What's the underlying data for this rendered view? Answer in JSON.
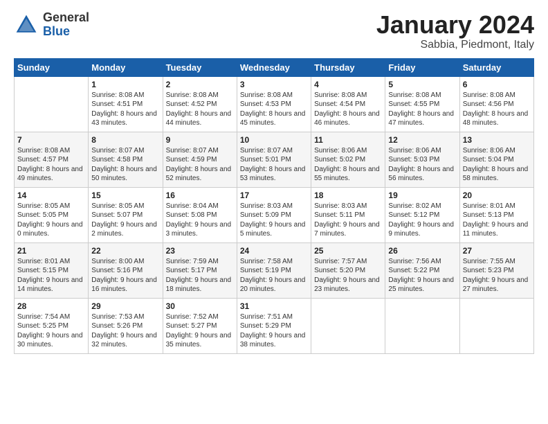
{
  "header": {
    "logo_general": "General",
    "logo_blue": "Blue",
    "month": "January 2024",
    "location": "Sabbia, Piedmont, Italy"
  },
  "weekdays": [
    "Sunday",
    "Monday",
    "Tuesday",
    "Wednesday",
    "Thursday",
    "Friday",
    "Saturday"
  ],
  "weeks": [
    [
      {
        "day": "",
        "sunrise": "",
        "sunset": "",
        "daylight": ""
      },
      {
        "day": "1",
        "sunrise": "Sunrise: 8:08 AM",
        "sunset": "Sunset: 4:51 PM",
        "daylight": "Daylight: 8 hours and 43 minutes."
      },
      {
        "day": "2",
        "sunrise": "Sunrise: 8:08 AM",
        "sunset": "Sunset: 4:52 PM",
        "daylight": "Daylight: 8 hours and 44 minutes."
      },
      {
        "day": "3",
        "sunrise": "Sunrise: 8:08 AM",
        "sunset": "Sunset: 4:53 PM",
        "daylight": "Daylight: 8 hours and 45 minutes."
      },
      {
        "day": "4",
        "sunrise": "Sunrise: 8:08 AM",
        "sunset": "Sunset: 4:54 PM",
        "daylight": "Daylight: 8 hours and 46 minutes."
      },
      {
        "day": "5",
        "sunrise": "Sunrise: 8:08 AM",
        "sunset": "Sunset: 4:55 PM",
        "daylight": "Daylight: 8 hours and 47 minutes."
      },
      {
        "day": "6",
        "sunrise": "Sunrise: 8:08 AM",
        "sunset": "Sunset: 4:56 PM",
        "daylight": "Daylight: 8 hours and 48 minutes."
      }
    ],
    [
      {
        "day": "7",
        "sunrise": "Sunrise: 8:08 AM",
        "sunset": "Sunset: 4:57 PM",
        "daylight": "Daylight: 8 hours and 49 minutes."
      },
      {
        "day": "8",
        "sunrise": "Sunrise: 8:07 AM",
        "sunset": "Sunset: 4:58 PM",
        "daylight": "Daylight: 8 hours and 50 minutes."
      },
      {
        "day": "9",
        "sunrise": "Sunrise: 8:07 AM",
        "sunset": "Sunset: 4:59 PM",
        "daylight": "Daylight: 8 hours and 52 minutes."
      },
      {
        "day": "10",
        "sunrise": "Sunrise: 8:07 AM",
        "sunset": "Sunset: 5:01 PM",
        "daylight": "Daylight: 8 hours and 53 minutes."
      },
      {
        "day": "11",
        "sunrise": "Sunrise: 8:06 AM",
        "sunset": "Sunset: 5:02 PM",
        "daylight": "Daylight: 8 hours and 55 minutes."
      },
      {
        "day": "12",
        "sunrise": "Sunrise: 8:06 AM",
        "sunset": "Sunset: 5:03 PM",
        "daylight": "Daylight: 8 hours and 56 minutes."
      },
      {
        "day": "13",
        "sunrise": "Sunrise: 8:06 AM",
        "sunset": "Sunset: 5:04 PM",
        "daylight": "Daylight: 8 hours and 58 minutes."
      }
    ],
    [
      {
        "day": "14",
        "sunrise": "Sunrise: 8:05 AM",
        "sunset": "Sunset: 5:05 PM",
        "daylight": "Daylight: 9 hours and 0 minutes."
      },
      {
        "day": "15",
        "sunrise": "Sunrise: 8:05 AM",
        "sunset": "Sunset: 5:07 PM",
        "daylight": "Daylight: 9 hours and 2 minutes."
      },
      {
        "day": "16",
        "sunrise": "Sunrise: 8:04 AM",
        "sunset": "Sunset: 5:08 PM",
        "daylight": "Daylight: 9 hours and 3 minutes."
      },
      {
        "day": "17",
        "sunrise": "Sunrise: 8:03 AM",
        "sunset": "Sunset: 5:09 PM",
        "daylight": "Daylight: 9 hours and 5 minutes."
      },
      {
        "day": "18",
        "sunrise": "Sunrise: 8:03 AM",
        "sunset": "Sunset: 5:11 PM",
        "daylight": "Daylight: 9 hours and 7 minutes."
      },
      {
        "day": "19",
        "sunrise": "Sunrise: 8:02 AM",
        "sunset": "Sunset: 5:12 PM",
        "daylight": "Daylight: 9 hours and 9 minutes."
      },
      {
        "day": "20",
        "sunrise": "Sunrise: 8:01 AM",
        "sunset": "Sunset: 5:13 PM",
        "daylight": "Daylight: 9 hours and 11 minutes."
      }
    ],
    [
      {
        "day": "21",
        "sunrise": "Sunrise: 8:01 AM",
        "sunset": "Sunset: 5:15 PM",
        "daylight": "Daylight: 9 hours and 14 minutes."
      },
      {
        "day": "22",
        "sunrise": "Sunrise: 8:00 AM",
        "sunset": "Sunset: 5:16 PM",
        "daylight": "Daylight: 9 hours and 16 minutes."
      },
      {
        "day": "23",
        "sunrise": "Sunrise: 7:59 AM",
        "sunset": "Sunset: 5:17 PM",
        "daylight": "Daylight: 9 hours and 18 minutes."
      },
      {
        "day": "24",
        "sunrise": "Sunrise: 7:58 AM",
        "sunset": "Sunset: 5:19 PM",
        "daylight": "Daylight: 9 hours and 20 minutes."
      },
      {
        "day": "25",
        "sunrise": "Sunrise: 7:57 AM",
        "sunset": "Sunset: 5:20 PM",
        "daylight": "Daylight: 9 hours and 23 minutes."
      },
      {
        "day": "26",
        "sunrise": "Sunrise: 7:56 AM",
        "sunset": "Sunset: 5:22 PM",
        "daylight": "Daylight: 9 hours and 25 minutes."
      },
      {
        "day": "27",
        "sunrise": "Sunrise: 7:55 AM",
        "sunset": "Sunset: 5:23 PM",
        "daylight": "Daylight: 9 hours and 27 minutes."
      }
    ],
    [
      {
        "day": "28",
        "sunrise": "Sunrise: 7:54 AM",
        "sunset": "Sunset: 5:25 PM",
        "daylight": "Daylight: 9 hours and 30 minutes."
      },
      {
        "day": "29",
        "sunrise": "Sunrise: 7:53 AM",
        "sunset": "Sunset: 5:26 PM",
        "daylight": "Daylight: 9 hours and 32 minutes."
      },
      {
        "day": "30",
        "sunrise": "Sunrise: 7:52 AM",
        "sunset": "Sunset: 5:27 PM",
        "daylight": "Daylight: 9 hours and 35 minutes."
      },
      {
        "day": "31",
        "sunrise": "Sunrise: 7:51 AM",
        "sunset": "Sunset: 5:29 PM",
        "daylight": "Daylight: 9 hours and 38 minutes."
      },
      {
        "day": "",
        "sunrise": "",
        "sunset": "",
        "daylight": ""
      },
      {
        "day": "",
        "sunrise": "",
        "sunset": "",
        "daylight": ""
      },
      {
        "day": "",
        "sunrise": "",
        "sunset": "",
        "daylight": ""
      }
    ]
  ]
}
